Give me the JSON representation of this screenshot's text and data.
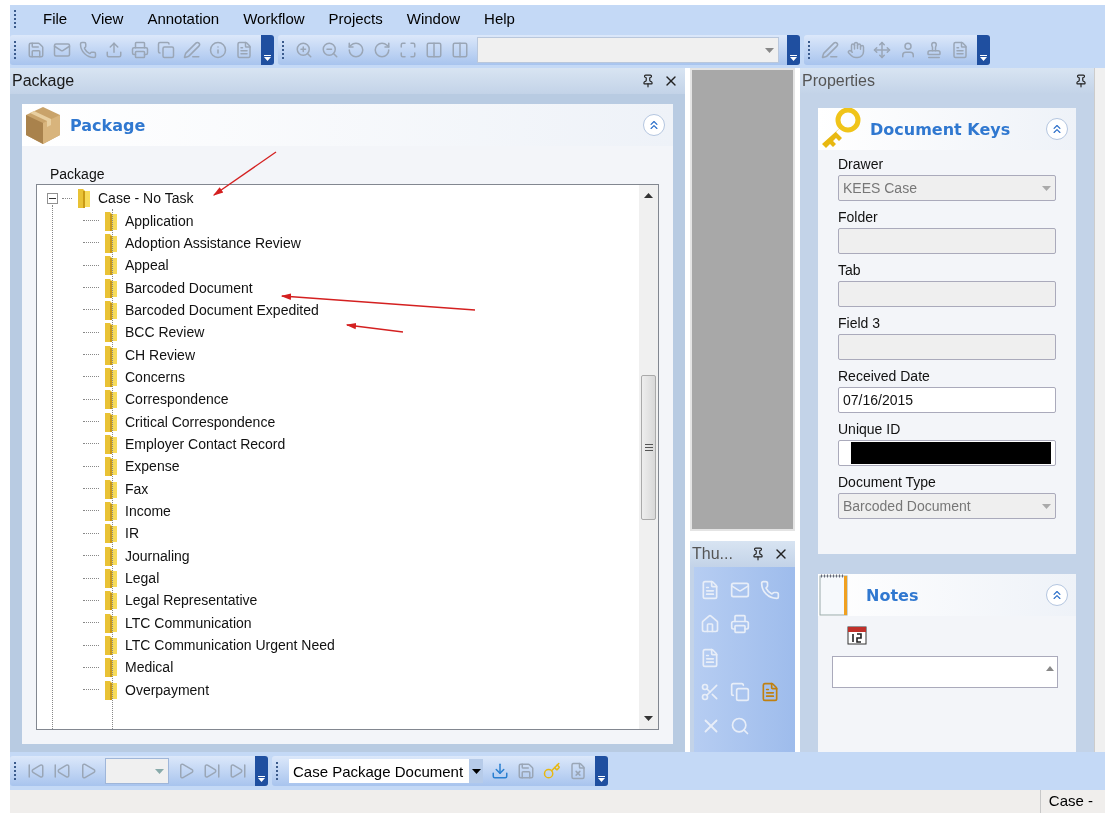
{
  "menu": [
    "File",
    "View",
    "Annotation",
    "Workflow",
    "Projects",
    "Window",
    "Help"
  ],
  "package_pane": {
    "title": "Package",
    "section_title": "Package",
    "tree_label": "Package",
    "tree": {
      "label": "Case - No Task",
      "expanded": true,
      "children": [
        {
          "label": "Application"
        },
        {
          "label": "Adoption Assistance Review"
        },
        {
          "label": "Appeal"
        },
        {
          "label": "Barcoded Document"
        },
        {
          "label": "Barcoded Document Expedited"
        },
        {
          "label": "BCC Review"
        },
        {
          "label": "CH Review"
        },
        {
          "label": "Concerns"
        },
        {
          "label": "Correspondence"
        },
        {
          "label": "Critical Correspondence"
        },
        {
          "label": "Employer Contact Record"
        },
        {
          "label": "Expense"
        },
        {
          "label": "Fax"
        },
        {
          "label": "Income"
        },
        {
          "label": "IR"
        },
        {
          "label": "Journaling"
        },
        {
          "label": "Legal"
        },
        {
          "label": "Legal Representative"
        },
        {
          "label": "LTC Communication"
        },
        {
          "label": "LTC Communication Urgent Need"
        },
        {
          "label": "Medical"
        },
        {
          "label": "Overpayment"
        }
      ]
    }
  },
  "thumbnails_pane": {
    "title": "Thu..."
  },
  "properties_pane": {
    "title": "Properties",
    "section_title": "Document Keys",
    "fields": [
      {
        "label": "Drawer",
        "kind": "dropdown",
        "value": "KEES Case",
        "disabled": true
      },
      {
        "label": "Folder",
        "kind": "text",
        "disabled": true
      },
      {
        "label": "Tab",
        "kind": "text",
        "disabled": true
      },
      {
        "label": "Field 3",
        "kind": "text",
        "disabled": true
      },
      {
        "label": "Received Date",
        "kind": "text",
        "value": "07/16/2015",
        "disabled": false
      },
      {
        "label": "Unique ID",
        "kind": "redacted",
        "disabled": false
      },
      {
        "label": "Document Type",
        "kind": "dropdown",
        "value": "Barcoded Document",
        "disabled": true
      }
    ],
    "notes_title": "Notes"
  },
  "bottom_toolbar": {
    "document_selector": "Case Package Document"
  },
  "status_bar": {
    "text": "Case -"
  }
}
